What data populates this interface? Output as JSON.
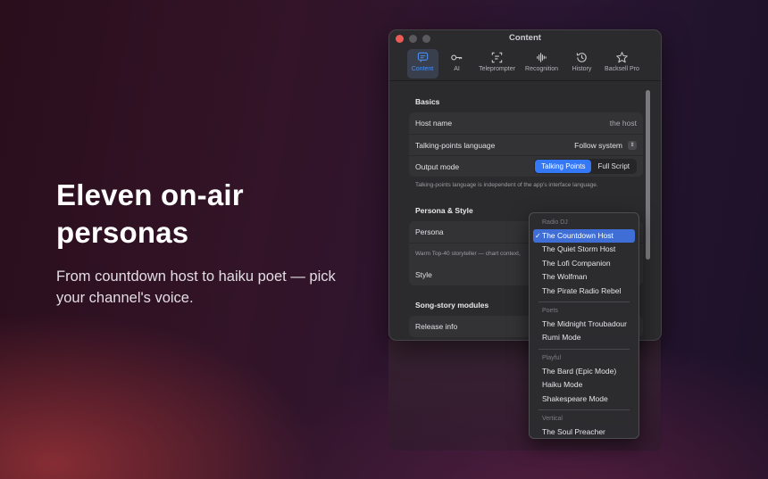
{
  "hero": {
    "title": "Eleven on-air personas",
    "subtitle": "From countdown host to haiku poet — pick your channel's voice."
  },
  "window": {
    "title": "Content",
    "tabs": [
      {
        "label": "Content",
        "icon": "content-icon",
        "active": true
      },
      {
        "label": "AI",
        "icon": "key-icon",
        "active": false
      },
      {
        "label": "Teleprompter",
        "icon": "teleprompter-icon",
        "active": false
      },
      {
        "label": "Recognition",
        "icon": "waveform-icon",
        "active": false
      },
      {
        "label": "History",
        "icon": "history-icon",
        "active": false
      },
      {
        "label": "Backsell Pro",
        "icon": "star-icon",
        "active": false
      }
    ]
  },
  "basics": {
    "title": "Basics",
    "host_name_label": "Host name",
    "host_name_value": "the host",
    "language_label": "Talking-points language",
    "language_value": "Follow system",
    "output_label": "Output mode",
    "output_options": [
      "Talking Points",
      "Full Script"
    ],
    "output_selected": "Talking Points",
    "note": "Talking-points language is independent of the app's interface language."
  },
  "persona": {
    "title": "Persona & Style",
    "persona_label": "Persona",
    "persona_desc": "Warm Top-40 storyteller — chart context,",
    "style_label": "Style"
  },
  "modules": {
    "title": "Song-story modules",
    "first_row": "Release info"
  },
  "menu": {
    "groups": [
      {
        "label": "Radio DJ",
        "items": [
          "The Countdown Host",
          "The Quiet Storm Host",
          "The Lofi Companion",
          "The Wolfman",
          "The Pirate Radio Rebel"
        ]
      },
      {
        "label": "Poets",
        "items": [
          "The Midnight Troubadour",
          "Rumi Mode"
        ]
      },
      {
        "label": "Playful",
        "items": [
          "The Bard (Epic Mode)",
          "Haiku Mode",
          "Shakespeare Mode"
        ]
      },
      {
        "label": "Vertical",
        "items": [
          "The Soul Preacher"
        ]
      }
    ],
    "selected": "The Countdown Host"
  },
  "colors": {
    "accent": "#3478f6",
    "menu_selection": "#3f6fd6",
    "close_light": "#ed5b57"
  }
}
